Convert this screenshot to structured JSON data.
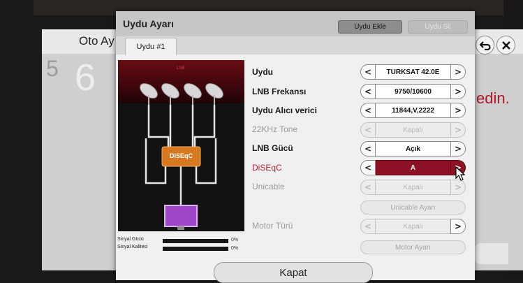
{
  "background": {
    "title": "Oto Ay",
    "step_small": "5",
    "step_big": "6",
    "text": "edin."
  },
  "dialog": {
    "title": "Uydu Ayarı",
    "add_button": "Uydu Ekle",
    "delete_button": "Uydu Sil",
    "tab": "Uydu #1",
    "close_button": "Kapat"
  },
  "diagram": {
    "top_label": "LNB",
    "switch_label": "DiSEqC"
  },
  "signal": {
    "strength_label": "Sinyal Gücü",
    "strength_value": "0%",
    "quality_label": "Sinyal Kalitesi",
    "quality_value": "0%"
  },
  "settings": {
    "satellite": {
      "label": "Uydu",
      "value": "TURKSAT 42.0E"
    },
    "lnb_freq": {
      "label": "LNB Frekansı",
      "value": "9750/10600"
    },
    "transponder": {
      "label": "Uydu Alıcı verici",
      "value": "11844,V,2222"
    },
    "tone": {
      "label": "22KHz Tone",
      "value": "Kapalı"
    },
    "lnb_power": {
      "label": "LNB Gücü",
      "value": "Açık"
    },
    "diseqc": {
      "label": "DiSEqC",
      "value": "A"
    },
    "unicable": {
      "label": "Unicable",
      "value": "Kapalı"
    },
    "unicable_settings": "Unicable Ayarı",
    "motor_type": {
      "label": "Motor Türü",
      "value": "Kapalı"
    },
    "motor_settings": "Motor Ayarı"
  },
  "colors": {
    "accent": "#8c1026",
    "active_label": "#b52237"
  }
}
